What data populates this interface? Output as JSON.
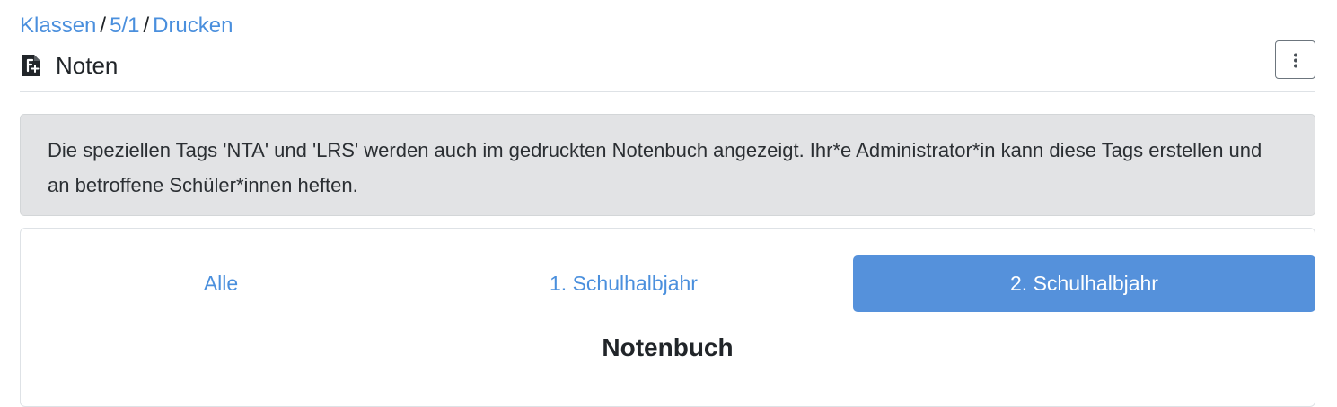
{
  "breadcrumb": {
    "items": [
      "Klassen",
      "5/1",
      "Drucken"
    ],
    "separator": "/"
  },
  "header": {
    "title": "Noten",
    "icon": "grade-document-icon",
    "menu_icon": "kebab-menu-icon"
  },
  "alert": {
    "text": "Die speziellen Tags 'NTA' und 'LRS' werden auch im gedruckten Notenbuch angezeigt. Ihr*e Administrator*in kann diese Tags erstellen und an betroffene Schüler*innen heften."
  },
  "tabs": [
    {
      "label": "Alle",
      "active": false
    },
    {
      "label": "1. Schulhalbjahr",
      "active": false
    },
    {
      "label": "2. Schulhalbjahr",
      "active": true
    }
  ],
  "section": {
    "title": "Notenbuch"
  },
  "colors": {
    "link": "#4a8fdd",
    "active_tab": "#5591db",
    "alert_bg": "#e2e3e5"
  }
}
